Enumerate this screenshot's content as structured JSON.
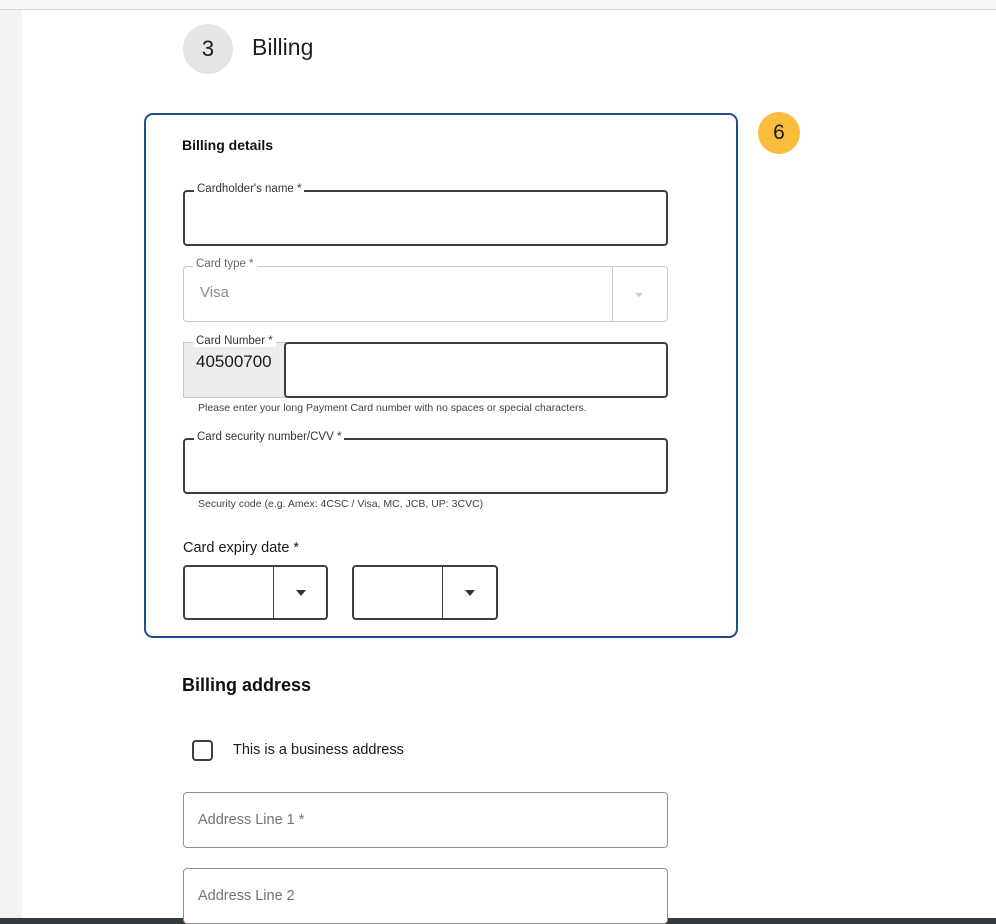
{
  "step": {
    "number": "3",
    "title": "Billing"
  },
  "badge": "6",
  "billing_details": {
    "heading": "Billing details",
    "cardholder_name": {
      "label": "Cardholder's name *",
      "value": ""
    },
    "card_type": {
      "label": "Card type *",
      "value": "Visa"
    },
    "card_number": {
      "label": "Card Number *",
      "prefix": "40500700",
      "value": "",
      "help": "Please enter your long Payment Card number with no spaces or special characters."
    },
    "cvv": {
      "label": "Card security number/CVV *",
      "value": "",
      "help": "Security code (e.g. Amex: 4CSC / Visa, MC, JCB, UP: 3CVC)"
    },
    "expiry": {
      "label": "Card expiry date *",
      "month": "",
      "year": ""
    }
  },
  "billing_address": {
    "heading": "Billing address",
    "business_checkbox": {
      "label": "This is a business address",
      "checked": false
    },
    "address_line_1": {
      "placeholder": "Address Line 1 *"
    },
    "address_line_2": {
      "placeholder": "Address Line 2"
    }
  },
  "colors": {
    "panel_border": "#1f4f8f",
    "badge": "#fbbd3d",
    "field_border": "#3a3f45",
    "disabled_border": "#c9c9c9",
    "step_circle": "#e6e6e6"
  }
}
